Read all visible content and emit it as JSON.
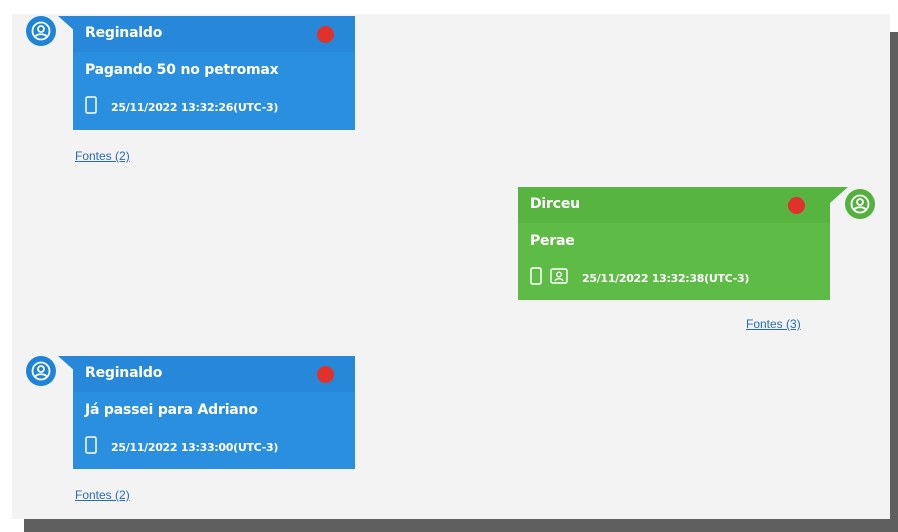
{
  "messages": [
    {
      "sender": "Reginaldo",
      "text": "Pagando 50 no petromax",
      "timestamp": "25/11/2022 13:32:26(UTC-3)",
      "sources_label": "Fontes (2)",
      "side": "left",
      "bubble_color": "#2b8fe0",
      "status_color": "#e0322a",
      "icons": [
        "phone-icon"
      ]
    },
    {
      "sender": "Dirceu",
      "text": "Perae",
      "timestamp": "25/11/2022 13:32:38(UTC-3)",
      "sources_label": "Fontes (3)",
      "side": "right",
      "bubble_color": "#5dbb46",
      "status_color": "#e0322a",
      "icons": [
        "phone-icon",
        "contact-card-icon"
      ]
    },
    {
      "sender": "Reginaldo",
      "text": "Já passei para Adriano",
      "timestamp": "25/11/2022 13:33:00(UTC-3)",
      "sources_label": "Fontes (2)",
      "side": "left",
      "bubble_color": "#2b8fe0",
      "status_color": "#e0322a",
      "icons": [
        "phone-icon"
      ]
    }
  ]
}
